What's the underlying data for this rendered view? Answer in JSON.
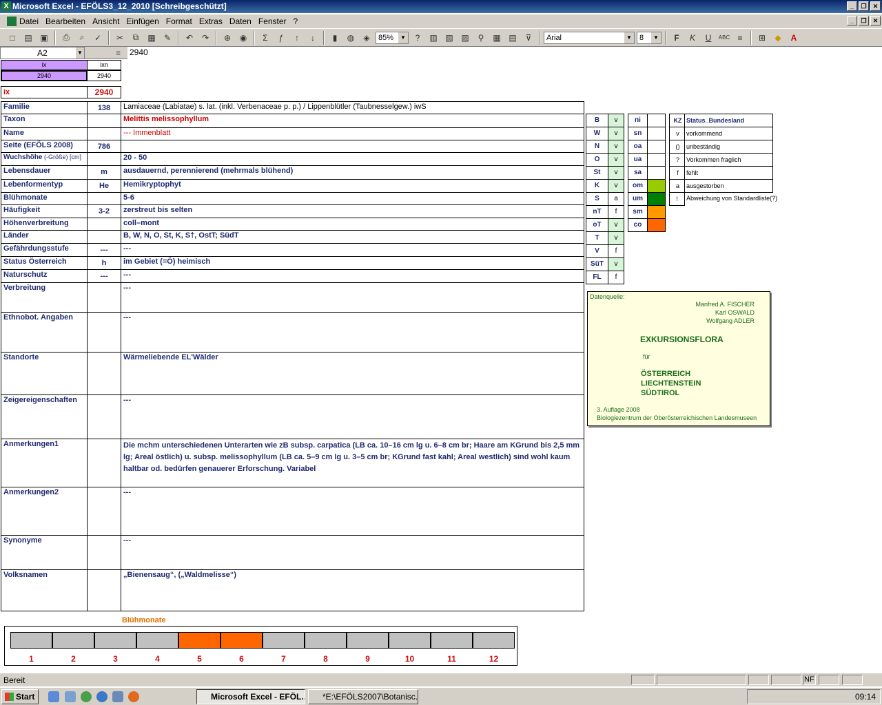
{
  "window": {
    "title": "Microsoft Excel - EFÖLS3_12_2010  [Schreibgeschützt]"
  },
  "menu": [
    "Datei",
    "Bearbeiten",
    "Ansicht",
    "Einfügen",
    "Format",
    "Extras",
    "Daten",
    "Fenster",
    "?"
  ],
  "toolbar": {
    "zoom": "85%",
    "font": "Arial",
    "size": "8"
  },
  "formula": {
    "cell": "A2",
    "eq": "=",
    "value": "2940"
  },
  "header": {
    "ix_label": "ix",
    "ixn_label": "ixn",
    "ix_val": "2940",
    "ixn_val": "2940",
    "ix_big_label": "ix",
    "ix_big_val": "2940"
  },
  "rows": [
    {
      "label": "Familie",
      "code": "138",
      "value": "Lamiaceae (Labiatae) s. lat. (inkl. Verbenaceae p. p.)  /  Lippenblütler (Taubnesselgew.) iwS"
    },
    {
      "label": "Taxon",
      "code": "",
      "value": "Melittis melissophyllum"
    },
    {
      "label": "Name",
      "code": "",
      "value": "--- Immenblatt"
    },
    {
      "label": "Seite (EFÖLS 2008)",
      "code": "786",
      "value": ""
    },
    {
      "label": "Wuchshöhe",
      "label_suffix": " (-Größe) [cm]",
      "code": "",
      "value": " 20 - 50"
    },
    {
      "label": "Lebensdauer",
      "code": "m",
      "value": "ausdauernd, perennierend (mehrmals blühend)"
    },
    {
      "label": "Lebenformentyp",
      "code": "He",
      "value": "Hemikryptophyt"
    },
    {
      "label": "Blühmonate",
      "code": "",
      "value": " 5-6"
    },
    {
      "label": "Häufigkeit",
      "code": "3-2",
      "value": "zerstreut bis selten"
    },
    {
      "label": "Höhenverbreitung",
      "code": "",
      "value": "coll–mont"
    },
    {
      "label": "Länder",
      "code": "",
      "value": "B, W, N, O, St, K, S†, OstT; SüdT"
    },
    {
      "label": "Gefährdungsstufe",
      "code": "---",
      "value": " ---"
    },
    {
      "label": "Status Österreich",
      "code": "h",
      "value": "im Gebiet (=Ö) heimisch"
    },
    {
      "label": "Naturschutz",
      "code": "---",
      "value": " ---"
    },
    {
      "label": "Verbreitung",
      "code": "",
      "value": " ---"
    },
    {
      "label": "Ethnobot. Angaben",
      "code": "",
      "value": "---"
    },
    {
      "label": "Standorte",
      "code": "",
      "value": "Wärmeliebende EL'Wälder"
    },
    {
      "label": "Zeigereigenschaften",
      "code": "",
      "value": "---"
    },
    {
      "label": "Anmerkungen1",
      "code": "",
      "value": "Die mchm unterschiedenen Unterarten wie zB subsp. carpatica (LB ca. 10–16 cm lg u. 6–8 cm br; Haare am KGrund bis 2,5 mm lg; Areal östlich) u. subsp. melissophyllum (LB ca. 5–9 cm lg u. 3–5 cm br; KGrund fast kahl; Areal westlich) sind wohl kaum haltbar od. bedürfen genauerer Erforschung.  Variabel"
    },
    {
      "label": "Anmerkungen2",
      "code": "",
      "value": "---"
    },
    {
      "label": "Synonyme",
      "code": "",
      "value": "---"
    },
    {
      "label": "Volksnamen",
      "code": "",
      "value": "„Bienensaug“, („Waldmelisse“)"
    }
  ],
  "laender": [
    [
      "B",
      "v"
    ],
    [
      "W",
      "v"
    ],
    [
      "N",
      "v"
    ],
    [
      "O",
      "v"
    ],
    [
      "St",
      "v"
    ],
    [
      "K",
      "v"
    ],
    [
      "S",
      "a"
    ],
    [
      "nT",
      "f"
    ],
    [
      "oT",
      "v"
    ],
    [
      "T",
      "v"
    ],
    [
      "V",
      "f"
    ],
    [
      "SüT",
      "v"
    ],
    [
      "FL",
      "f"
    ]
  ],
  "hoehen": [
    [
      "ni",
      ""
    ],
    [
      "sn",
      ""
    ],
    [
      "oa",
      ""
    ],
    [
      "ua",
      ""
    ],
    [
      "sa",
      ""
    ],
    [
      "om",
      "#99cc00"
    ],
    [
      "um",
      "#008000"
    ],
    [
      "sm",
      "#ff9900"
    ],
    [
      "co",
      "#ff6600"
    ]
  ],
  "status": {
    "head_kz": "KZ",
    "head_label": "Status_Bundesland",
    "items": [
      [
        "v",
        "vorkommend"
      ],
      [
        "()",
        "unbeständig"
      ],
      [
        "?",
        "Vorkommen fraglich"
      ],
      [
        "f",
        "fehlt"
      ],
      [
        "a",
        "ausgestorben"
      ]
    ],
    "extra_kz": "!",
    "extra_label": "Abweichung von Standardliste(?)"
  },
  "source": {
    "heading": "Datenquelle:",
    "authors": [
      "Manfred A. FISCHER",
      "Karl OSWALD",
      "Wolfgang ADLER"
    ],
    "title": "EXKURSIONSFLORA",
    "fuer": "für",
    "regions": [
      "ÖSTERREICH",
      "LIECHTENSTEIN",
      "SÜDTIROL"
    ],
    "edition": "3. Auflage 2008",
    "publisher": "Biologiezentrum der Oberösterreichischen Landesmuseen"
  },
  "bluete": {
    "title": "Blühmonate",
    "months": [
      "1",
      "2",
      "3",
      "4",
      "5",
      "6",
      "7",
      "8",
      "9",
      "10",
      "11",
      "12"
    ],
    "active": [
      5,
      6
    ],
    "active_color": "#ff6600",
    "inactive_color": "#c0c0c0"
  },
  "statusbar": {
    "text": "Bereit",
    "nf": "NF"
  },
  "taskbar": {
    "start": "Start",
    "tasks": [
      "Microsoft Excel - EFÖL...",
      "*E:\\EFÖLS2007\\Botanisc..."
    ],
    "time": "09:14"
  }
}
